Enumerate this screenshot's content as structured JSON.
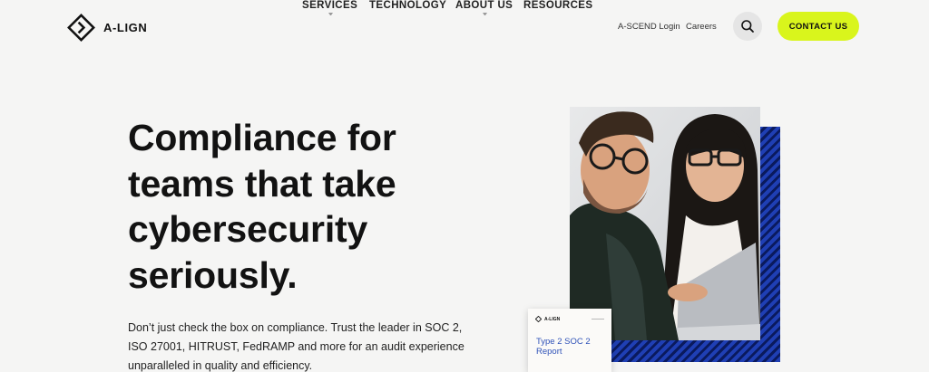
{
  "brand": {
    "name": "A-LIGN"
  },
  "nav": [
    {
      "label": "SERVICES",
      "has_dropdown": true
    },
    {
      "label": "TECHNOLOGY",
      "has_dropdown": false
    },
    {
      "label": "ABOUT US",
      "has_dropdown": true
    },
    {
      "label": "RESOURCES",
      "has_dropdown": false
    }
  ],
  "utility_links": [
    "A-SCEND Login",
    "Careers"
  ],
  "search": {
    "icon": "search-icon"
  },
  "contact": {
    "label": "CONTACT US"
  },
  "colors": {
    "accent": "#d9f51c",
    "stripe_blue": "#1f3fb4",
    "report_blue": "#2f52b8"
  },
  "hero": {
    "title_lines": [
      "Compliance for",
      "teams that take",
      "cybersecurity",
      "seriously."
    ],
    "description": "Don’t just check the box on compliance. Trust the leader in SOC 2, ISO 27001, HITRUST, FedRAMP and more for an audit experience unparalleled in quality and efficiency."
  },
  "report_card": {
    "brand": "A-LIGN",
    "title": "Type 2 SOC 2 Report"
  }
}
